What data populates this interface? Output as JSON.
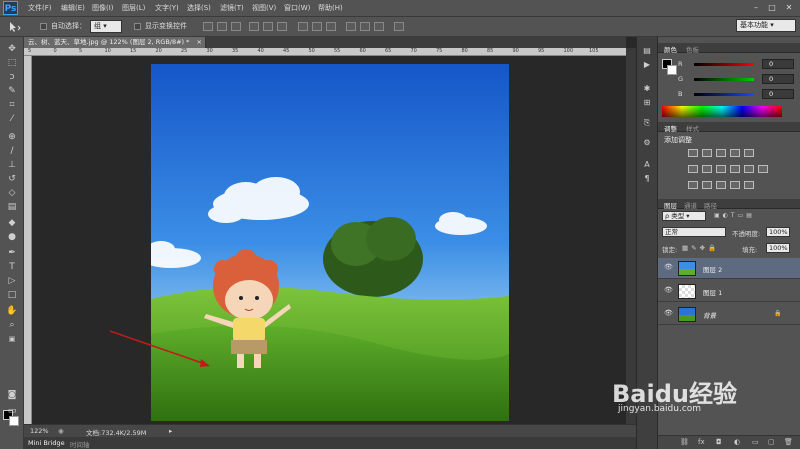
{
  "app": {
    "logo": "Ps"
  },
  "menu": [
    "文件(F)",
    "编辑(E)",
    "图像(I)",
    "图层(L)",
    "文字(Y)",
    "选择(S)",
    "滤镜(T)",
    "视图(V)",
    "窗口(W)",
    "帮助(H)"
  ],
  "window_controls": {
    "min": "–",
    "max": "□",
    "close": "✕"
  },
  "options": {
    "auto_select_label": "自动选择：",
    "auto_select_value": "组",
    "show_transform_label": "显示变换控件",
    "workspace": "基本功能"
  },
  "document": {
    "tab_title": "云、树、蓝天、草地.jpg @ 122% (图层 2, RGB/8#) *",
    "tab_close": "×",
    "zoom": "122%",
    "doc_size": "文档:732.4K/2.59M"
  },
  "ruler": {
    "h_ticks": [
      "5",
      "0",
      "5",
      "10",
      "15",
      "20",
      "25",
      "30",
      "35",
      "40",
      "45",
      "50",
      "55",
      "60",
      "65",
      "70",
      "75",
      "80",
      "85",
      "90",
      "95",
      "100",
      "105"
    ]
  },
  "bottom_tabs": {
    "mini_bridge": "Mini Bridge",
    "timeline": "时间轴"
  },
  "color_panel": {
    "tabs": [
      "颜色",
      "色板"
    ],
    "channels": [
      {
        "label": "R",
        "value": "0",
        "color": "#e03030"
      },
      {
        "label": "G",
        "value": "0",
        "color": "#30c030"
      },
      {
        "label": "B",
        "value": "0",
        "color": "#3050e0"
      }
    ]
  },
  "adjustments_panel": {
    "tabs": [
      "调整",
      "样式"
    ],
    "title": "添加调整"
  },
  "layers_panel": {
    "tabs": [
      "图层",
      "通道",
      "路径"
    ],
    "filter_kind": "ρ 类型",
    "blend_mode": "正常",
    "opacity_label": "不透明度:",
    "opacity_value": "100%",
    "lock_label": "锁定:",
    "fill_label": "填充:",
    "fill_value": "100%",
    "layers": [
      {
        "name": "图层 2",
        "selected": true,
        "thumb": "kid"
      },
      {
        "name": "图层 1",
        "selected": false,
        "thumb": "transparent"
      },
      {
        "name": "背景",
        "selected": false,
        "thumb": "landscape",
        "locked": true
      }
    ],
    "footer_icons": [
      "link-icon",
      "fx-icon",
      "mask-icon",
      "adjustment-icon",
      "folder-icon",
      "new-layer-icon",
      "trash-icon"
    ]
  },
  "watermark": {
    "brand": "Baidu经验",
    "url": "jingyan.baidu.com"
  },
  "colors": {
    "panel": "#535353",
    "canvas_bg": "#282828",
    "selected_layer": "#5d6a80",
    "sky_top": "#1a5fd0",
    "grass": "#4a9a1e"
  }
}
